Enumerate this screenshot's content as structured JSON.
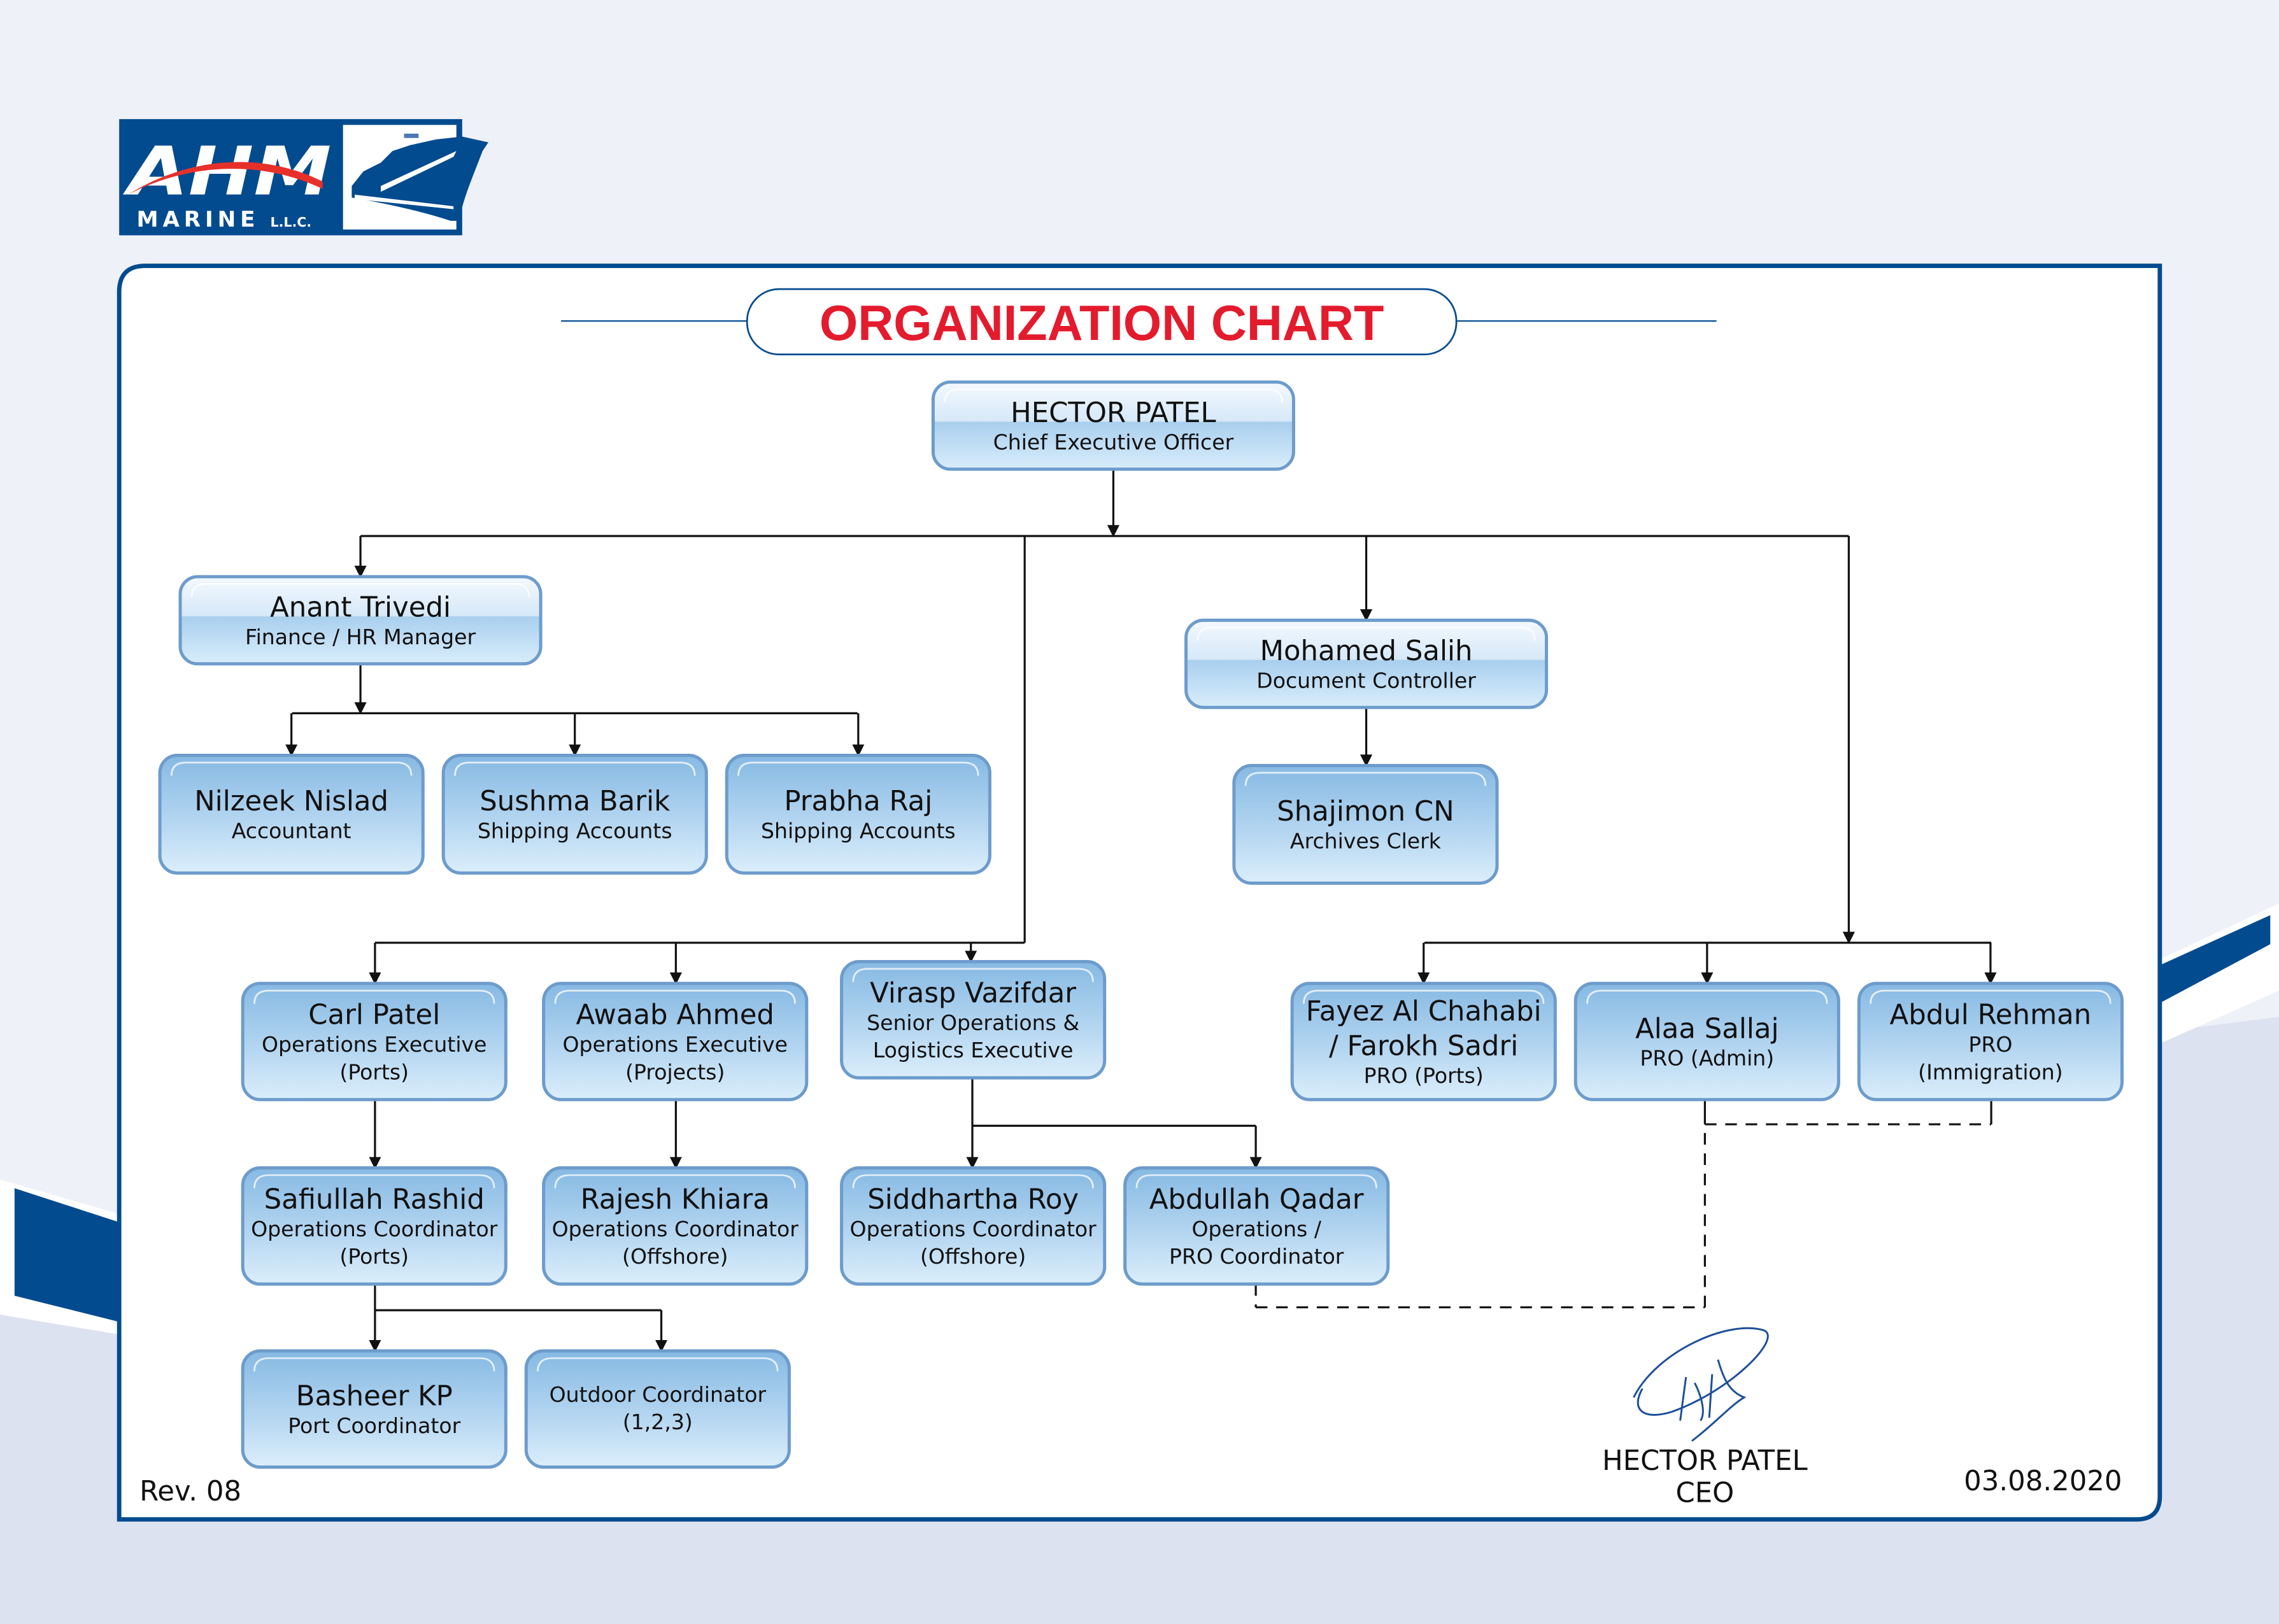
{
  "company": {
    "logo_main": "AHM",
    "logo_sub": "MARINE",
    "logo_suffix": "L.L.C."
  },
  "title": "ORGANIZATION CHART",
  "colors": {
    "brand_blue": "#034b8f",
    "title_red": "#e31b2d",
    "box_border": "#6d9ccc",
    "box_top": "#86b9e3",
    "box_bottom": "#dbeefb",
    "background_top": "#eef1f8",
    "background_bottom": "#dce2ef"
  },
  "nodes": [
    {
      "id": "ceo",
      "name": "HECTOR PATEL",
      "role": [
        "Chief Executive Officer"
      ]
    },
    {
      "id": "anant",
      "name": "Anant Trivedi",
      "role": [
        "Finance / HR Manager"
      ]
    },
    {
      "id": "nilzeek",
      "name": "Nilzeek Nislad",
      "role": [
        "Accountant"
      ]
    },
    {
      "id": "sushma",
      "name": "Sushma Barik",
      "role": [
        "Shipping Accounts"
      ]
    },
    {
      "id": "prabha",
      "name": "Prabha Raj",
      "role": [
        "Shipping Accounts"
      ]
    },
    {
      "id": "mohamed",
      "name": "Mohamed Salih",
      "role": [
        "Document Controller"
      ]
    },
    {
      "id": "shajimon",
      "name": "Shajimon CN",
      "role": [
        "Archives Clerk"
      ]
    },
    {
      "id": "carl",
      "name": "Carl Patel",
      "role": [
        "Operations Executive",
        "(Ports)"
      ]
    },
    {
      "id": "awaab",
      "name": "Awaab Ahmed",
      "role": [
        "Operations Executive",
        "(Projects)"
      ]
    },
    {
      "id": "virasp",
      "name": "Virasp Vazifdar",
      "role": [
        "Senior Operations &",
        "Logistics Executive"
      ]
    },
    {
      "id": "safiullah",
      "name": "Safiullah Rashid",
      "role": [
        "Operations Coordinator",
        "(Ports)"
      ]
    },
    {
      "id": "rajesh",
      "name": "Rajesh Khiara",
      "role": [
        "Operations Coordinator",
        "(Offshore)"
      ]
    },
    {
      "id": "siddhartha",
      "name": "Siddhartha Roy",
      "role": [
        "Operations Coordinator",
        "(Offshore)"
      ]
    },
    {
      "id": "abdullah",
      "name": "Abdullah Qadar",
      "role": [
        "Operations /",
        "PRO Coordinator"
      ]
    },
    {
      "id": "basheer",
      "name": "Basheer KP",
      "role": [
        "Port Coordinator"
      ]
    },
    {
      "id": "outdoor",
      "name": "",
      "role": [
        "Outdoor Coordinator",
        "(1,2,3)"
      ]
    },
    {
      "id": "fayez",
      "name": "Fayez Al Chahabi",
      "name2": "/ Farokh Sadri",
      "role": [
        "PRO (Ports)"
      ]
    },
    {
      "id": "alaa",
      "name": "Alaa Sallaj",
      "role": [
        "PRO (Admin)"
      ]
    },
    {
      "id": "abdul",
      "name": "Abdul Rehman",
      "role": [
        "PRO",
        "(Immigration)"
      ]
    }
  ],
  "relationships": [
    {
      "from": "ceo",
      "to": [
        "anant",
        "virasp",
        "mohamed",
        "fayez",
        "alaa",
        "abdul"
      ],
      "type": "solid"
    },
    {
      "from": "anant",
      "to": [
        "nilzeek",
        "sushma",
        "prabha"
      ],
      "type": "solid"
    },
    {
      "from": "mohamed",
      "to": [
        "shajimon"
      ],
      "type": "solid"
    },
    {
      "from": "ceo",
      "to": [
        "carl",
        "awaab"
      ],
      "type": "solid"
    },
    {
      "from": "carl",
      "to": [
        "safiullah"
      ],
      "type": "solid"
    },
    {
      "from": "awaab",
      "to": [
        "rajesh"
      ],
      "type": "solid"
    },
    {
      "from": "virasp",
      "to": [
        "siddhartha",
        "abdullah"
      ],
      "type": "solid"
    },
    {
      "from": "safiullah",
      "to": [
        "basheer",
        "outdoor"
      ],
      "type": "solid"
    },
    {
      "from": "abdullah",
      "to": [
        "alaa",
        "abdul"
      ],
      "type": "dashed"
    }
  ],
  "footer": {
    "revision": "Rev. 08",
    "signatory_name": "HECTOR PATEL",
    "signatory_title": "CEO",
    "date": "03.08.2020"
  }
}
